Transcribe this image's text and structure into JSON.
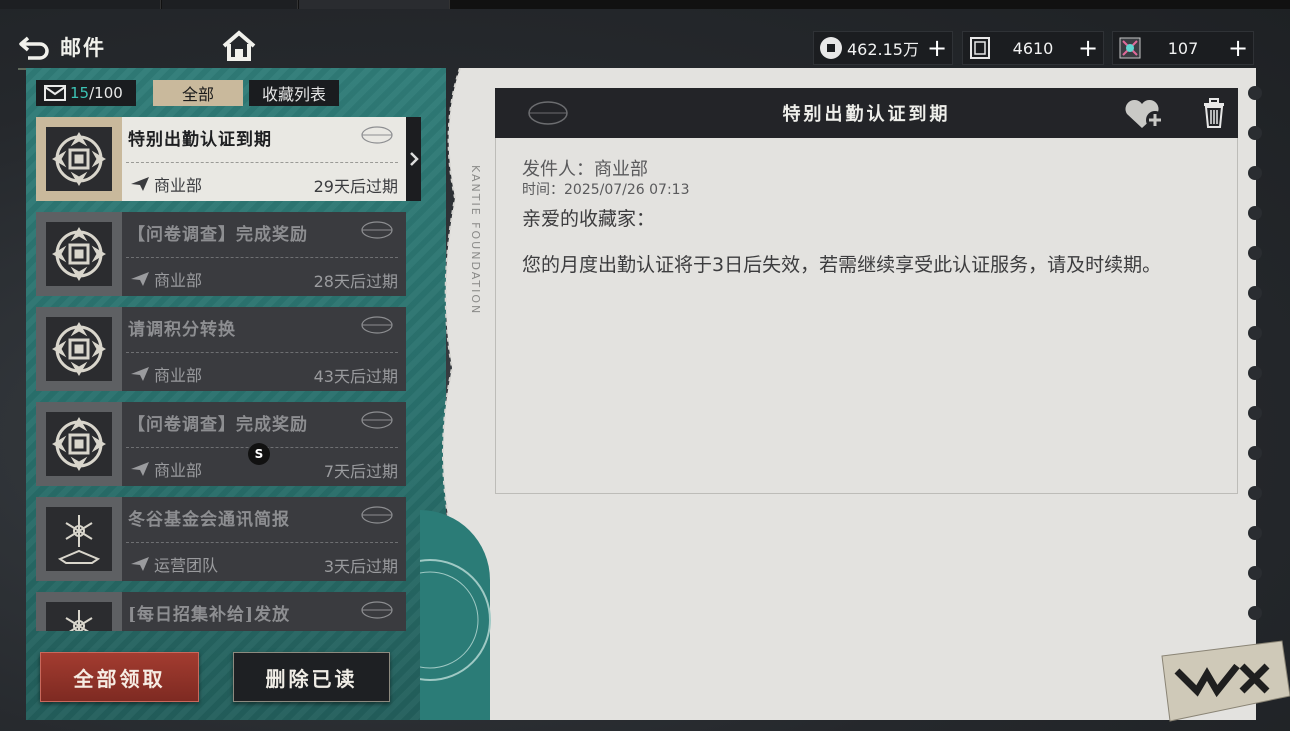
{
  "header": {
    "title": "邮件",
    "resources": [
      {
        "icon": "coin-icon",
        "value": "462.15万"
      },
      {
        "icon": "ticket-icon",
        "value": "4610"
      },
      {
        "icon": "crystal-icon",
        "value": "107"
      }
    ]
  },
  "mailbox": {
    "count_current": "15",
    "count_total": "/100",
    "tab_all": "全部",
    "tab_favorites": "收藏列表"
  },
  "mails": [
    {
      "title": "特别出勤认证到期",
      "sender": "商业部",
      "expires": "29天后过期",
      "active": true,
      "thumb": "emblem"
    },
    {
      "title": "【问卷调查】完成奖励",
      "sender": "商业部",
      "expires": "28天后过期",
      "active": false,
      "thumb": "emblem"
    },
    {
      "title": "请调积分转换",
      "sender": "商业部",
      "expires": "43天后过期",
      "active": false,
      "thumb": "emblem"
    },
    {
      "title": "【问卷调查】完成奖励",
      "sender": "商业部",
      "expires": "7天后过期",
      "active": false,
      "thumb": "emblem"
    },
    {
      "title": "冬谷基金会通讯简报",
      "sender": "运营团队",
      "expires": "3天后过期",
      "active": false,
      "thumb": "snowflake"
    },
    {
      "title": "[每日招集补给]发放",
      "sender": "",
      "expires": "",
      "active": false,
      "thumb": "snowflake"
    }
  ],
  "badge": "S",
  "buttons": {
    "collect_all": "全部领取",
    "delete_read": "删除已读"
  },
  "message": {
    "title": "特别出勤认证到期",
    "sender_line": "发件人：商业部",
    "time_line": "时间：2025/07/26  07:13",
    "greeting": "亲爱的收藏家：",
    "body": "您的月度出勤认证将于3日后失效，若需继续享受此认证服务，请及时续期。"
  },
  "decor": {
    "logo_text": "W.B.X",
    "vertical_text": "KANTIE FOUNDATION"
  },
  "colors": {
    "teal_panel": "#2f7c78",
    "count_accent": "#3cc3b5",
    "collect_button": "#a33c30",
    "active_tab": "#c9b99c"
  }
}
